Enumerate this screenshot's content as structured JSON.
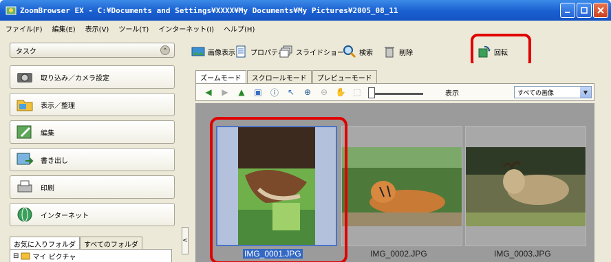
{
  "window": {
    "title": "ZoomBrowser EX - C:¥Documents and Settings¥XXXX¥My Documents¥My Pictures¥2005_08_11"
  },
  "menu": [
    "ファイル(F)",
    "編集(E)",
    "表示(V)",
    "ツール(T)",
    "インターネット(I)",
    "ヘルプ(H)"
  ],
  "tasks": {
    "header": "タスク",
    "items": [
      {
        "label": "取り込み／カメラ設定",
        "icon": "camera-icon"
      },
      {
        "label": "表示／整理",
        "icon": "folder-icon"
      },
      {
        "label": "編集",
        "icon": "edit-icon"
      },
      {
        "label": "書き出し",
        "icon": "export-icon"
      },
      {
        "label": "印刷",
        "icon": "printer-icon"
      },
      {
        "label": "インターネット",
        "icon": "internet-icon"
      }
    ]
  },
  "folders": {
    "tabs": [
      "お気に入りフォルダ",
      "すべてのフォルダ"
    ],
    "root": "マイ ピクチャ"
  },
  "toolbar": {
    "image_view": "画像表示",
    "properties": "プロパティ",
    "slideshow": "スライドショー",
    "search": "検索",
    "delete": "削除",
    "rotate": "回転"
  },
  "view": {
    "tabs": [
      "ズームモード",
      "スクロールモード",
      "プレビューモード"
    ],
    "display_label": "表示",
    "display_value": "すべての画像"
  },
  "thumbnails": [
    {
      "name": "IMG_0001.JPG",
      "selected": true
    },
    {
      "name": "IMG_0002.JPG",
      "selected": false
    },
    {
      "name": "IMG_0003.JPG",
      "selected": false
    }
  ],
  "colors": {
    "highlight": "#e00000",
    "selection": "#3368c4",
    "titlebar": "#1a5fd0"
  }
}
